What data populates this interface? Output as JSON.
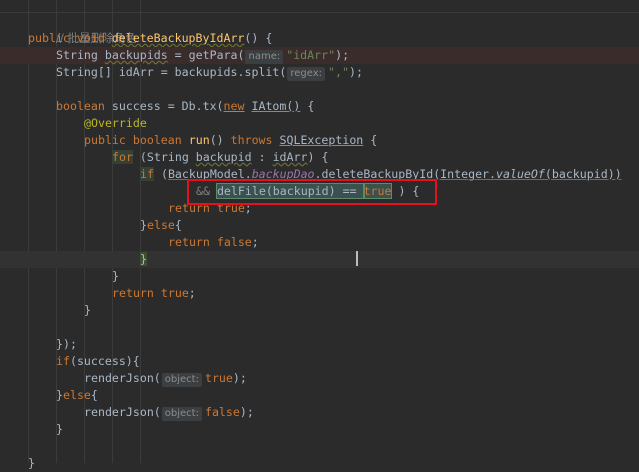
{
  "editor": {
    "comment": "// 批量删除角色",
    "lines": {
      "l2": {
        "kw1": "public",
        "kw2": "void",
        "method": "deleteBackupByIdArr",
        "rest": "() {"
      },
      "l3": {
        "type": "String",
        "var": "backupids",
        "eq": " = getPara(",
        "hint": "name:",
        "str": "\"idArr\"",
        "end": ");"
      },
      "l4": {
        "type": "String[]",
        "var": " idArr = backupids.split(",
        "hint": "regex:",
        "str": "\",\"",
        "end": ");"
      },
      "l6": {
        "kw": "boolean",
        "a": " success = Db.tx(",
        "newkw": "new",
        "cls": "IAtom()",
        "end": " {"
      },
      "l7": {
        "ann": "@Override"
      },
      "l8": {
        "kw1": "public",
        "kw2": "boolean",
        "fn": "run",
        "paren": "() ",
        "kw3": "throws",
        "exc": "SQLException",
        "end": " {"
      },
      "l9": {
        "kw": "for",
        "a": " (String ",
        "var": "backupid",
        "b": " : ",
        "arr": "idArr",
        "end": ") {"
      },
      "l10": {
        "kw": "if",
        "a": " (",
        "cls": "BackupModel.",
        "fld": "backupDao",
        "call": ".deleteBackupById(Integer.",
        "valueof": "valueOf",
        "arg": "(backupid))"
      },
      "l11": {
        "op": "&& ",
        "expr": "delFile(backupid) == ",
        "kwtrue": "true",
        "end": " ) {"
      },
      "l12": {
        "kw": "return",
        "val": "true",
        "end": ";"
      },
      "l13": {
        "close": "}",
        "kw": "else",
        "open": "{"
      },
      "l14": {
        "kw": "return",
        "val": "false",
        "end": ";"
      },
      "l15": {
        "close": "}"
      },
      "l16": {
        "close": "}"
      },
      "l17": {
        "kw": "return",
        "val": "true",
        "end": ";"
      },
      "l18": {
        "close": "}"
      },
      "l20": {
        "close": "});"
      },
      "l21": {
        "kw": "if",
        "rest": "(success){"
      },
      "l22": {
        "call": "renderJson(",
        "hint": "object:",
        "val": "true",
        "end": ");"
      },
      "l23": {
        "close": "}",
        "kw": "else",
        "open": "{"
      },
      "l24": {
        "call": "renderJson(",
        "hint": "object:",
        "val": "false",
        "end": ");"
      },
      "l25": {
        "close": "}"
      },
      "l27": {
        "close": "}"
      }
    }
  },
  "colors": {
    "background": "#2b2b2b",
    "keyword": "#cc7832",
    "string": "#6a8759",
    "annotation": "#bbb529",
    "highlight_border": "#e3101e"
  }
}
